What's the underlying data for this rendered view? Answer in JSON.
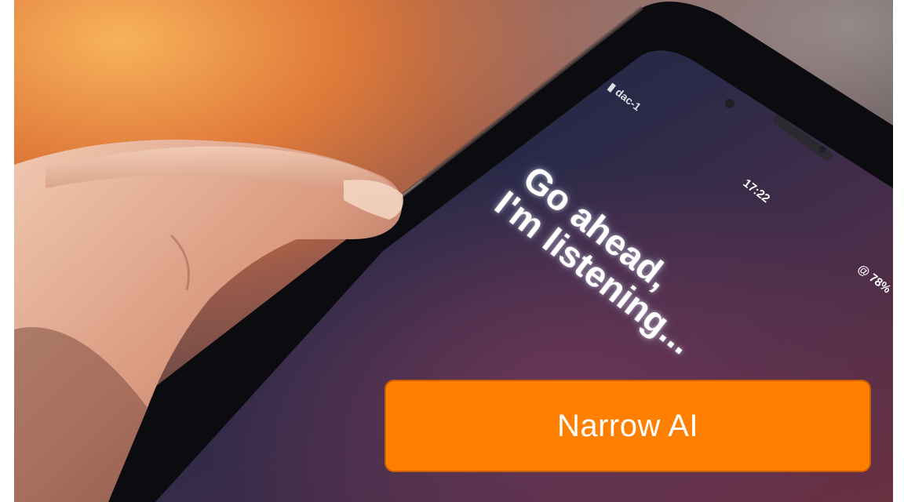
{
  "photo": {
    "description_icon": "phone-in-hand-photo",
    "screen": {
      "carrier": "▮ dac-1",
      "assistant_line1": "Go ahead,",
      "assistant_line2": "I'm listening...",
      "clock": "17:22",
      "battery": "@ 78%"
    }
  },
  "caption": {
    "label": "Narrow AI",
    "color": "#ff7f00"
  }
}
